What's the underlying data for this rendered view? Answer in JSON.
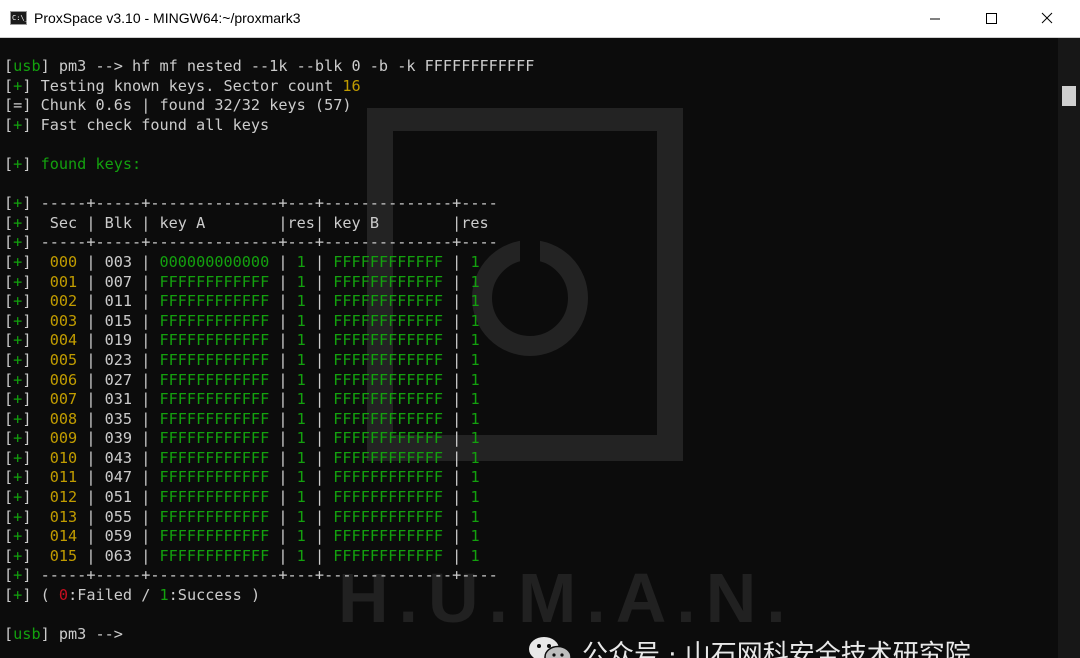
{
  "window": {
    "title": "ProxSpace v3.10 - MINGW64:~/proxmark3",
    "icon_text": "C:\\_",
    "icon": "console-icon"
  },
  "colors": {
    "green": "#13a10e",
    "yellow": "#c19c00",
    "gray": "#cccccc",
    "red": "#c50f1f",
    "background": "#0c0c0c"
  },
  "terminal": {
    "cmd": {
      "prompt_open": "[",
      "prompt_word": "usb",
      "prompt_close": "] pm3 --> ",
      "text": "hf mf nested --1k --blk 0 -b -k FFFFFFFFFFFF"
    },
    "testing": {
      "tag": "+",
      "text": " Testing known keys. Sector count ",
      "count": "16"
    },
    "chunk": {
      "tag": "=",
      "text": " Chunk 0.6s | found 32/32 keys (57)"
    },
    "fast": {
      "tag": "+",
      "text": " Fast check found all keys"
    },
    "found_keys": {
      "tag": "+",
      "text": " found keys:"
    },
    "table": {
      "separator": " -----+-----+--------------+---+--------------+----",
      "header": {
        "col_sec": "Sec",
        "col_blk": "Blk",
        "col_keya": "key A",
        "col_resa": "res",
        "col_keyb": "key B",
        "col_resb": "res"
      },
      "rows": [
        {
          "sec": "000",
          "blk": "003",
          "keya": "000000000000",
          "resa": "1",
          "keyb": "FFFFFFFFFFFF",
          "resb": "1"
        },
        {
          "sec": "001",
          "blk": "007",
          "keya": "FFFFFFFFFFFF",
          "resa": "1",
          "keyb": "FFFFFFFFFFFF",
          "resb": "1"
        },
        {
          "sec": "002",
          "blk": "011",
          "keya": "FFFFFFFFFFFF",
          "resa": "1",
          "keyb": "FFFFFFFFFFFF",
          "resb": "1"
        },
        {
          "sec": "003",
          "blk": "015",
          "keya": "FFFFFFFFFFFF",
          "resa": "1",
          "keyb": "FFFFFFFFFFFF",
          "resb": "1"
        },
        {
          "sec": "004",
          "blk": "019",
          "keya": "FFFFFFFFFFFF",
          "resa": "1",
          "keyb": "FFFFFFFFFFFF",
          "resb": "1"
        },
        {
          "sec": "005",
          "blk": "023",
          "keya": "FFFFFFFFFFFF",
          "resa": "1",
          "keyb": "FFFFFFFFFFFF",
          "resb": "1"
        },
        {
          "sec": "006",
          "blk": "027",
          "keya": "FFFFFFFFFFFF",
          "resa": "1",
          "keyb": "FFFFFFFFFFFF",
          "resb": "1"
        },
        {
          "sec": "007",
          "blk": "031",
          "keya": "FFFFFFFFFFFF",
          "resa": "1",
          "keyb": "FFFFFFFFFFFF",
          "resb": "1"
        },
        {
          "sec": "008",
          "blk": "035",
          "keya": "FFFFFFFFFFFF",
          "resa": "1",
          "keyb": "FFFFFFFFFFFF",
          "resb": "1"
        },
        {
          "sec": "009",
          "blk": "039",
          "keya": "FFFFFFFFFFFF",
          "resa": "1",
          "keyb": "FFFFFFFFFFFF",
          "resb": "1"
        },
        {
          "sec": "010",
          "blk": "043",
          "keya": "FFFFFFFFFFFF",
          "resa": "1",
          "keyb": "FFFFFFFFFFFF",
          "resb": "1"
        },
        {
          "sec": "011",
          "blk": "047",
          "keya": "FFFFFFFFFFFF",
          "resa": "1",
          "keyb": "FFFFFFFFFFFF",
          "resb": "1"
        },
        {
          "sec": "012",
          "blk": "051",
          "keya": "FFFFFFFFFFFF",
          "resa": "1",
          "keyb": "FFFFFFFFFFFF",
          "resb": "1"
        },
        {
          "sec": "013",
          "blk": "055",
          "keya": "FFFFFFFFFFFF",
          "resa": "1",
          "keyb": "FFFFFFFFFFFF",
          "resb": "1"
        },
        {
          "sec": "014",
          "blk": "059",
          "keya": "FFFFFFFFFFFF",
          "resa": "1",
          "keyb": "FFFFFFFFFFFF",
          "resb": "1"
        },
        {
          "sec": "015",
          "blk": "063",
          "keya": "FFFFFFFFFFFF",
          "resa": "1",
          "keyb": "FFFFFFFFFFFF",
          "resb": "1"
        }
      ]
    },
    "legend": {
      "tag": "+",
      "open": " ( ",
      "failed_code": "0",
      "failed_text": ":Failed / ",
      "success_code": "1",
      "success_text": ":Success )"
    },
    "final_prompt": {
      "prompt_open": "[",
      "prompt_word": "usb",
      "prompt_close": "] pm3 -->"
    }
  },
  "watermark": {
    "wechat_icon": "wechat-icon",
    "text": "公众号 · 山石网科安全技术研究院",
    "brand": "H.U.M.A.N."
  }
}
